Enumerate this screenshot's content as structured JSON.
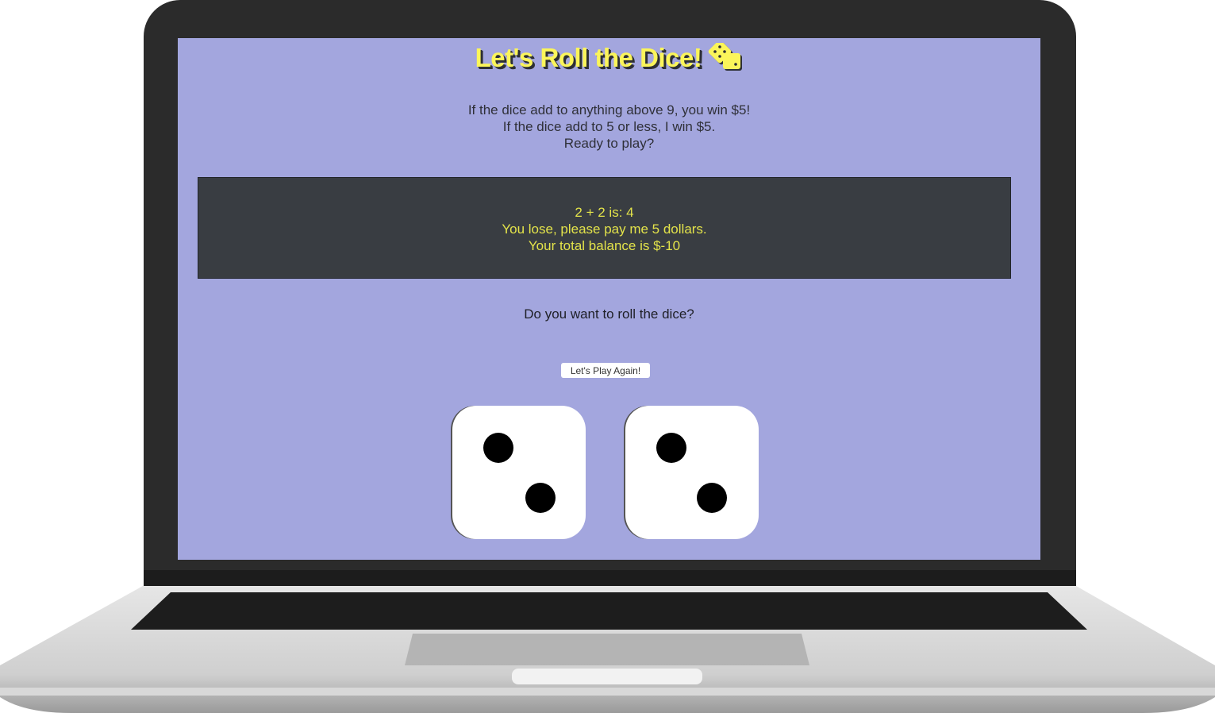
{
  "page": {
    "title": "Let's Roll the Dice!",
    "title_icon": "dice-icon",
    "rules": [
      "If the dice add to anything above 9, you win $5!",
      "If the dice add to 5 or less, I win $5.",
      "Ready to play?"
    ],
    "result": [
      "2 + 2 is: 4",
      "You lose, please pay me 5 dollars.",
      "Your total balance is $-10"
    ],
    "question": "Do you want to roll the dice?",
    "play_button": "Let's Play Again!",
    "dice": [
      2,
      2
    ]
  },
  "colors": {
    "background": "#a3a6de",
    "title": "#fbf55a",
    "result_panel": "#393d42",
    "result_text": "#e3e34a"
  }
}
